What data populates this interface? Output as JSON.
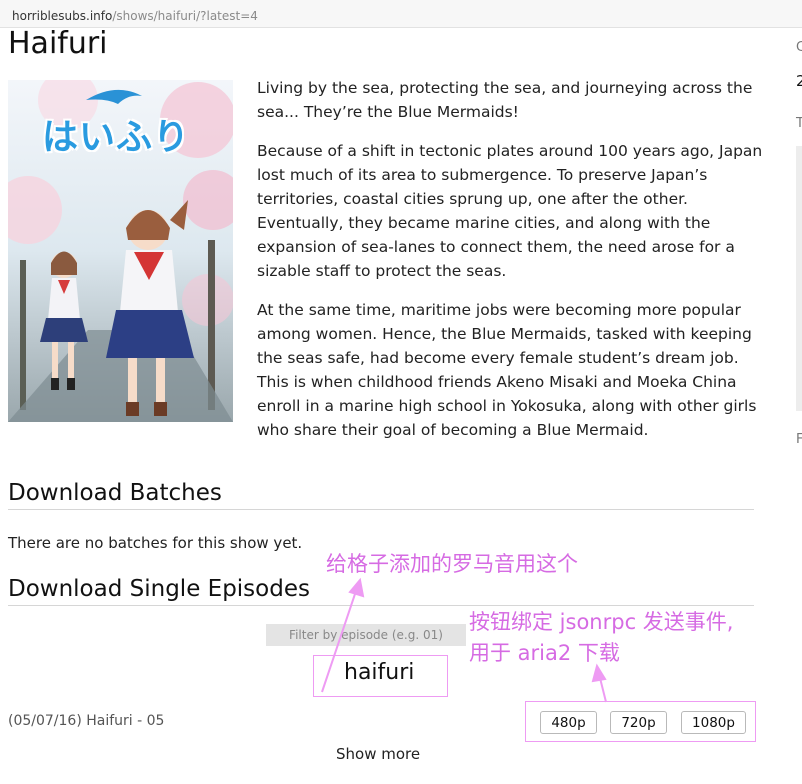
{
  "browser": {
    "url_host": "horriblesubs.info",
    "url_path": "/shows/haifuri/?latest=4"
  },
  "show": {
    "title": "Haifuri",
    "poster_logo": "はいふり",
    "synopsis": [
      "Living by the sea, protecting the sea, and journeying across the sea... They’re the Blue Mermaids!",
      "Because of a shift in tectonic plates around 100 years ago, Japan lost much of its area to submergence. To preserve Japan’s territories, coastal cities sprung up, one after the other. Eventually, they became marine cities, and along with the expansion of sea-lanes to connect them, the need arose for a sizable staff to protect the seas.",
      "At the same time, maritime jobs were becoming more popular among women. Hence, the Blue Mermaids, tasked with keeping the seas safe, had become every female student’s dream job. This is when childhood friends Akeno Misaki and Moeka China enroll in a marine high school in Yokosuka, along with other girls who share their goal of becoming a Blue Mermaid."
    ]
  },
  "batches": {
    "title": "Download Batches",
    "empty_text": "There are no batches for this show yet."
  },
  "episodes": {
    "title": "Download Single Episodes",
    "filter_placeholder": "Filter by episode (e.g. 01)",
    "rows": [
      {
        "label": "(05/07/16) Haifuri - 05",
        "resolutions": [
          "480p",
          "720p",
          "1080p"
        ]
      }
    ],
    "show_more": "Show more"
  },
  "sidebar_fragments": [
    "C",
    "2",
    "T",
    "F"
  ],
  "annotations": {
    "grid_note": "给格子添加的罗马音用这个",
    "romaji_value": "haifuri",
    "button_note_line1": "按钮绑定 jsonrpc 发送事件,",
    "button_note_line2": "用于 aria2 下载",
    "color": "#d66be3"
  }
}
